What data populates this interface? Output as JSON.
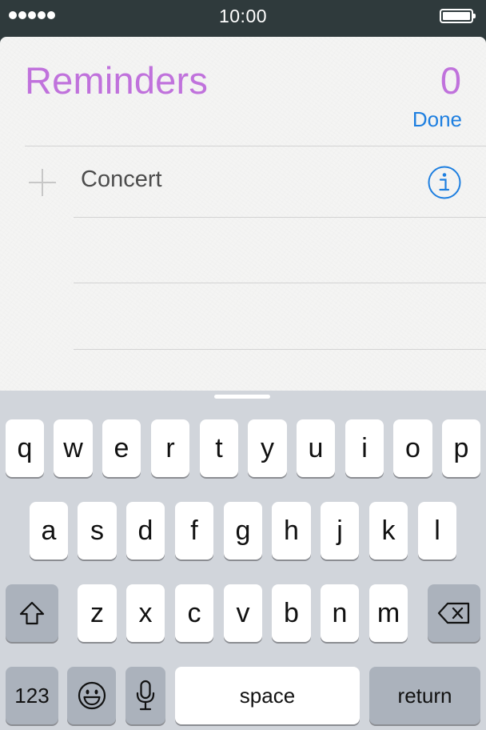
{
  "status_bar": {
    "time": "10:00"
  },
  "list": {
    "title": "Reminders",
    "count": "0",
    "done_label": "Done",
    "items": [
      {
        "text": "Concert"
      }
    ]
  },
  "keyboard": {
    "row1": [
      "q",
      "w",
      "e",
      "r",
      "t",
      "y",
      "u",
      "i",
      "o",
      "p"
    ],
    "row2": [
      "a",
      "s",
      "d",
      "f",
      "g",
      "h",
      "j",
      "k",
      "l"
    ],
    "row3": [
      "z",
      "x",
      "c",
      "v",
      "b",
      "n",
      "m"
    ],
    "numbers_label": "123",
    "space_label": "space",
    "return_label": "return"
  },
  "colors": {
    "list_accent": "#c072dc",
    "link_blue": "#1e7fe0",
    "status_bar_bg": "#2f3a3c",
    "keyboard_bg": "#d1d5db"
  },
  "icons": [
    "signal-dots-icon",
    "battery-icon",
    "plus-icon",
    "info-icon",
    "shift-icon",
    "backspace-icon",
    "emoji-icon",
    "microphone-icon"
  ]
}
